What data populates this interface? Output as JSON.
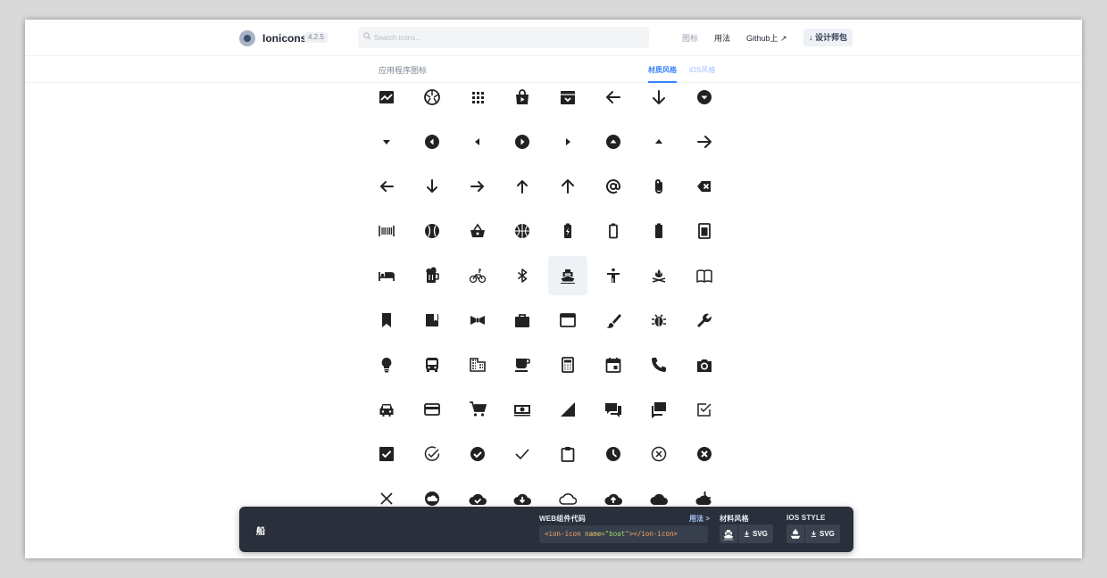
{
  "header": {
    "brand": "Ionicons",
    "version": "4.2.5",
    "search_placeholder": "Search icons...",
    "nav": [
      {
        "label": "图标",
        "active": false
      },
      {
        "label": "用法",
        "active": true
      },
      {
        "label": "Github上 ↗",
        "active": true
      }
    ],
    "designer_pack": "↓ 设计师包"
  },
  "section": {
    "title": "应用程序图标",
    "tabs": [
      {
        "label": "材质风格",
        "active": true
      },
      {
        "label": "iOS风格",
        "active": false
      }
    ]
  },
  "icons": {
    "rows": [
      [
        "analytics",
        "aperture",
        "apps",
        "appstore",
        "archive",
        "arrow-back",
        "arrow-down",
        "arrow-dropdown-circle"
      ],
      [
        "arrow-dropdown",
        "arrow-dropleft-circle",
        "arrow-dropleft",
        "arrow-dropright-circle",
        "arrow-dropright",
        "arrow-dropup-circle",
        "arrow-dropup",
        "arrow-forward"
      ],
      [
        "arrow-round-back",
        "arrow-round-down",
        "arrow-round-forward",
        "arrow-round-up",
        "arrow-up",
        "at",
        "attach",
        "backspace"
      ],
      [
        "barcode",
        "baseball",
        "basket",
        "basketball",
        "battery-charging",
        "battery-dead",
        "battery-full",
        "beaker"
      ],
      [
        "bed",
        "beer",
        "bicycle",
        "bluetooth",
        "boat",
        "body",
        "bonfire",
        "book"
      ],
      [
        "bookmark",
        "bookmarks",
        "bowtie",
        "briefcase",
        "browsers",
        "brush",
        "bug",
        "build"
      ],
      [
        "bulb",
        "bus",
        "business",
        "cafe",
        "calculator",
        "calendar",
        "call",
        "camera"
      ],
      [
        "car",
        "card",
        "cart",
        "cash",
        "cellular",
        "chatboxes",
        "chatbubbles",
        "checkbox-outline"
      ],
      [
        "checkbox",
        "checkmark-circle-outline",
        "checkmark-circle",
        "checkmark",
        "clipboard",
        "clock",
        "close-circle-outline",
        "close-circle"
      ],
      [
        "close",
        "cloud-circle",
        "cloud-done",
        "cloud-download",
        "cloud-outline",
        "cloud-upload",
        "cloud",
        "cloudy-night"
      ]
    ],
    "selected": "boat"
  },
  "bottom_panel": {
    "selected_name": "船",
    "web_component_label": "WEB组件代码",
    "usage_link": "用法 >",
    "code_tag_open": "<ion-icon",
    "code_attr": "name=",
    "code_value": "\"boat\"",
    "code_tag_close": "></ion-icon>",
    "material_label": "材料风格",
    "ios_label": "IOS STYLE",
    "svg_label": "SVG"
  }
}
